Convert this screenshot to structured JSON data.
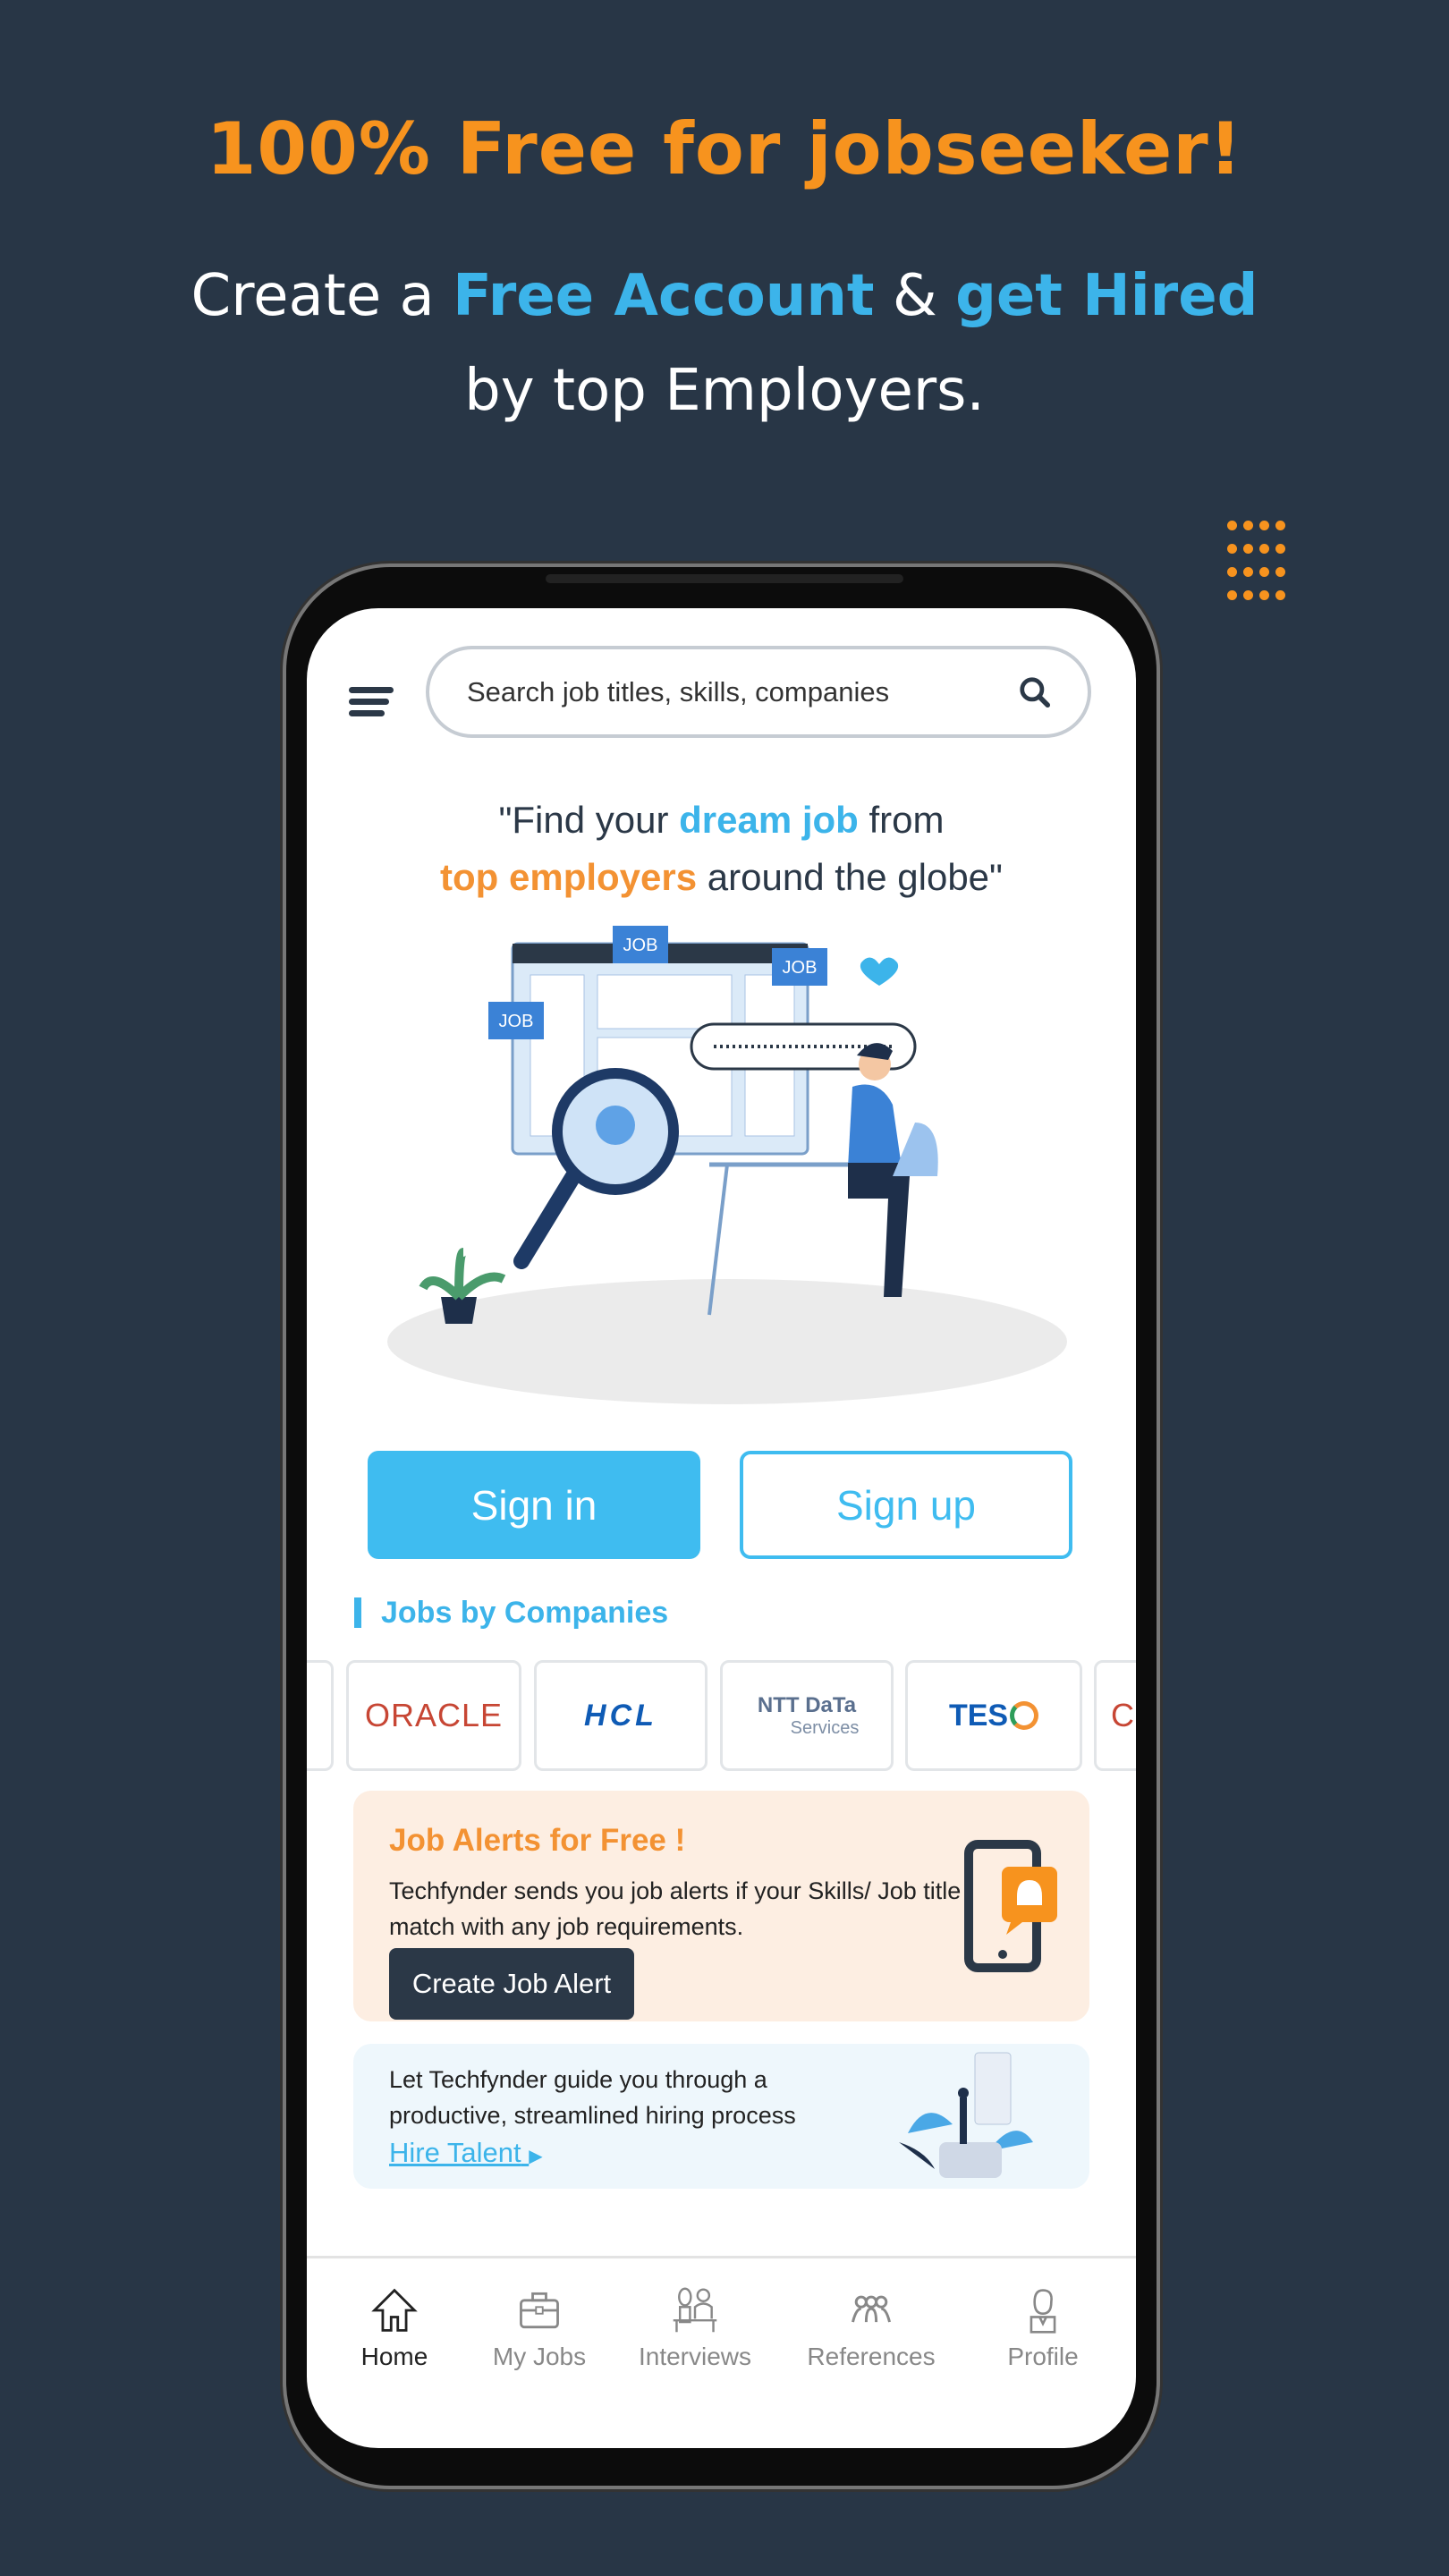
{
  "promo": {
    "headline": "100% Free for jobseeker!",
    "line1_a": "Create a ",
    "line1_b": "Free Account",
    "line1_c": " & ",
    "line1_d": "get Hired",
    "line2": "by top Employers."
  },
  "colors": {
    "background": "#283646",
    "orange": "#f7931e",
    "blue": "#3cb4ea",
    "dark": "#2b3847"
  },
  "app": {
    "search": {
      "placeholder": "Search job titles, skills, companies",
      "icon": "search-icon"
    },
    "tagline": {
      "a": "\"Find your ",
      "b": "dream job",
      "c": " from",
      "d": "top employers",
      "e": " around the globe\""
    },
    "illustration_labels": [
      "JOB",
      "JOB",
      "JOB"
    ],
    "signin": "Sign in",
    "signup": "Sign up",
    "companies_title": "Jobs by Companies",
    "companies": [
      "ORACLE",
      "HCL",
      "NTT DaTa",
      "Services",
      "TES"
    ],
    "alert": {
      "title": "Job Alerts for Free !",
      "desc": "Techfynder sends you job alerts if your Skills/ Job title match with any job requirements.",
      "button": "Create Job Alert"
    },
    "hire": {
      "desc1": "Let Techfynder guide you through a",
      "desc2": "productive, streamlined hiring process",
      "link": "Hire Talent"
    },
    "nav": [
      {
        "label": "Home",
        "icon": "home-icon",
        "active": true
      },
      {
        "label": "My Jobs",
        "icon": "briefcase-icon"
      },
      {
        "label": "Interviews",
        "icon": "interviews-icon"
      },
      {
        "label": "References",
        "icon": "people-group-icon"
      },
      {
        "label": "Profile",
        "icon": "profile-icon"
      }
    ]
  }
}
